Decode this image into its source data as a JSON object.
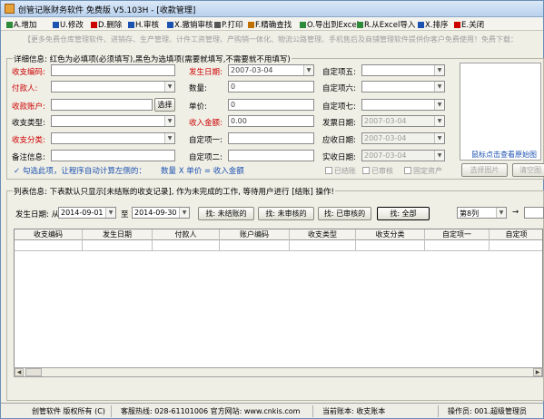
{
  "window": {
    "title": "创管记账财务软件 免费版 V5.103H - [收款管理]"
  },
  "menu": [
    {
      "label": "A.增加",
      "icon": "add-icon",
      "color": "#2e8b3a"
    },
    {
      "label": "U.修改",
      "icon": "edit-icon",
      "color": "#1d52b0"
    },
    {
      "label": "D.删除",
      "icon": "delete-icon",
      "color": "#cc0000"
    },
    {
      "label": "H.审核",
      "icon": "audit-icon",
      "color": "#1d52b0"
    },
    {
      "label": "X.撤销审核",
      "icon": "undo-audit-icon",
      "color": "#1d52b0"
    },
    {
      "label": "P.打印",
      "icon": "print-icon",
      "color": "#555555"
    },
    {
      "label": "F.精确查找",
      "icon": "search-icon",
      "color": "#c07000"
    },
    {
      "label": "O.导出到Excel",
      "icon": "export-excel-icon",
      "color": "#2e8b3a"
    },
    {
      "label": "R.从Excel导入",
      "icon": "import-excel-icon",
      "color": "#2e8b3a"
    },
    {
      "label": "X.排序",
      "icon": "sort-icon",
      "color": "#1d52b0"
    },
    {
      "label": "E.关闭",
      "icon": "close-icon",
      "color": "#cc0000"
    }
  ],
  "ad": {
    "text": "【更多免费仓库管理软件、进销存、生产管理、计件工资管理、产购销一体化、物流公路管理、手机售后及商铺管理软件提供你客户免费使用！免费下载："
  },
  "details": {
    "legend": "详细信息: 红色为必填项(必须填写),黑色为选填项(需要就填写,不需要就不用填写)",
    "left": [
      {
        "label": "收支编码:",
        "value": "",
        "type": "text",
        "required": true
      },
      {
        "label": "付款人:",
        "value": "",
        "type": "dropdown",
        "required": true
      },
      {
        "label": "收款账户:",
        "value": "",
        "type": "button",
        "button": "选择",
        "required": true
      },
      {
        "label": "收支类型:",
        "value": "",
        "type": "dropdown",
        "required": false
      },
      {
        "label": "收支分类:",
        "value": "",
        "type": "dropdown",
        "required": true
      },
      {
        "label": "备注信息:",
        "value": "",
        "type": "text",
        "required": false
      }
    ],
    "middle": [
      {
        "label": "发生日期:",
        "value": "2007-03-04",
        "type": "dropdown",
        "required": true
      },
      {
        "label": "数量:",
        "value": "0",
        "type": "text",
        "required": false
      },
      {
        "label": "单价:",
        "value": "0",
        "type": "text",
        "required": false
      },
      {
        "label": "收入金额:",
        "value": "0.00",
        "type": "text",
        "required": true
      },
      {
        "label": "自定项一:",
        "value": "",
        "type": "text",
        "required": false
      },
      {
        "label": "自定项二:",
        "value": "",
        "type": "text",
        "required": false
      }
    ],
    "right": [
      {
        "label": "自定项五:",
        "value": "",
        "type": "dropdown",
        "disabled": false
      },
      {
        "label": "自定项六:",
        "value": "",
        "type": "dropdown",
        "disabled": false
      },
      {
        "label": "自定项七:",
        "value": "",
        "type": "dropdown",
        "disabled": false
      },
      {
        "label": "发票日期:",
        "value": "2007-03-04",
        "type": "dropdown",
        "disabled": true
      },
      {
        "label": "应收日期:",
        "value": "2007-03-04",
        "type": "dropdown",
        "disabled": true
      },
      {
        "label": "实收日期:",
        "value": "2007-03-04",
        "type": "dropdown",
        "disabled": true
      }
    ],
    "auto_calc_label": "勾选此项，让程序自动计算左侧的：",
    "formula": "数量 X 单价 = 收入金额",
    "checks": [
      "已结账",
      "已审核",
      "固定资产"
    ],
    "image_hint": "鼠标点击查看原始图",
    "image_select": "选择图片",
    "image_clear": "清空图"
  },
  "list": {
    "legend": "列表信息: 下表默认只显示[未结账的收支记录], 作为未完成的工作, 等待用户进行 [结账] 操作!",
    "date_label": "发生日期: 从",
    "date_from": "2014-09-01",
    "to_label": "至",
    "date_to": "2014-09-30",
    "filter_buttons": [
      "找: 未结账的",
      "找: 未审核的",
      "找: 已审核的",
      "找: 全部"
    ],
    "column_select": "第8列",
    "arrow": "→",
    "columns": [
      "收支编码",
      "发生日期",
      "付款人",
      "账户编码",
      "收支类型",
      "收支分类",
      "自定项一",
      "自定项"
    ]
  },
  "status": {
    "company": "创管软件 版权所有 (C)",
    "hotline": "客服热线: 028-61101006 官方网站: www.cnkis.com",
    "account": "当前账本: 收支账本",
    "operator": "操作员: 001.超级管理员"
  }
}
